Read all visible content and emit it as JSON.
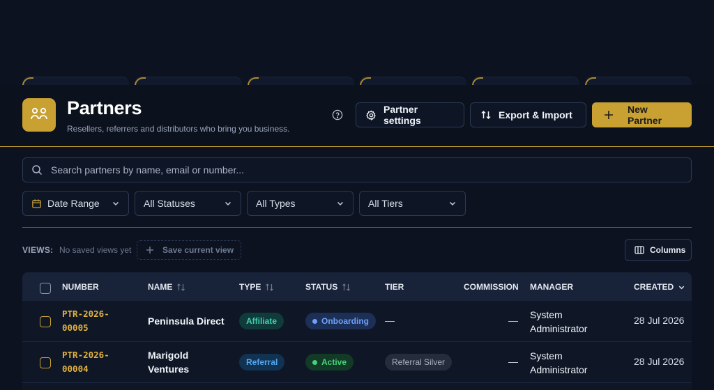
{
  "header": {
    "title": "Partners",
    "subtitle": "Resellers, referrers and distributors who bring you business.",
    "settings_label": "Partner settings",
    "export_label": "Export & Import",
    "new_label": "New Partner"
  },
  "search": {
    "placeholder": "Search partners by name, email or number..."
  },
  "filters": {
    "date_range": "Date Range",
    "statuses": "All Statuses",
    "types": "All Types",
    "tiers": "All Tiers"
  },
  "views": {
    "label": "VIEWS:",
    "empty": "No saved views yet",
    "save_label": "Save current view",
    "columns_label": "Columns"
  },
  "table": {
    "columns": {
      "number": "NUMBER",
      "name": "NAME",
      "type": "TYPE",
      "status": "STATUS",
      "tier": "TIER",
      "commission": "COMMISSION",
      "manager": "MANAGER",
      "created": "CREATED"
    },
    "rows": [
      {
        "number": "PTR-2026-00005",
        "name": "Peninsula Direct",
        "type": "Affiliate",
        "status": "Onboarding",
        "tier": "—",
        "commission": "—",
        "manager": "System Administrator",
        "created": "28 Jul 2026"
      },
      {
        "number": "PTR-2026-00004",
        "name": "Marigold Ventures",
        "type": "Referral",
        "status": "Active",
        "tier": "Referral Silver",
        "commission": "—",
        "manager": "System Administrator",
        "created": "28 Jul 2026"
      }
    ]
  },
  "colors": {
    "accent": "#c9a132",
    "affiliate_bg": "#0f3b3a",
    "affiliate_text": "#3fd1b0",
    "referral_bg": "#123252",
    "referral_text": "#55a7f0",
    "onboarding_bg": "#1c2f57",
    "onboarding_text": "#6fa0f5",
    "active_bg": "#133a26",
    "active_text": "#46d17a",
    "tier_bg": "#252d3b",
    "tier_text": "#aab3c2"
  },
  "icons": {
    "app": "partners-people-icon",
    "help": "help-circle-icon",
    "settings": "gear-icon",
    "export": "swap-vertical-icon",
    "new": "plus-icon",
    "search": "search-icon",
    "date": "calendar-icon",
    "columns": "columns-icon"
  }
}
